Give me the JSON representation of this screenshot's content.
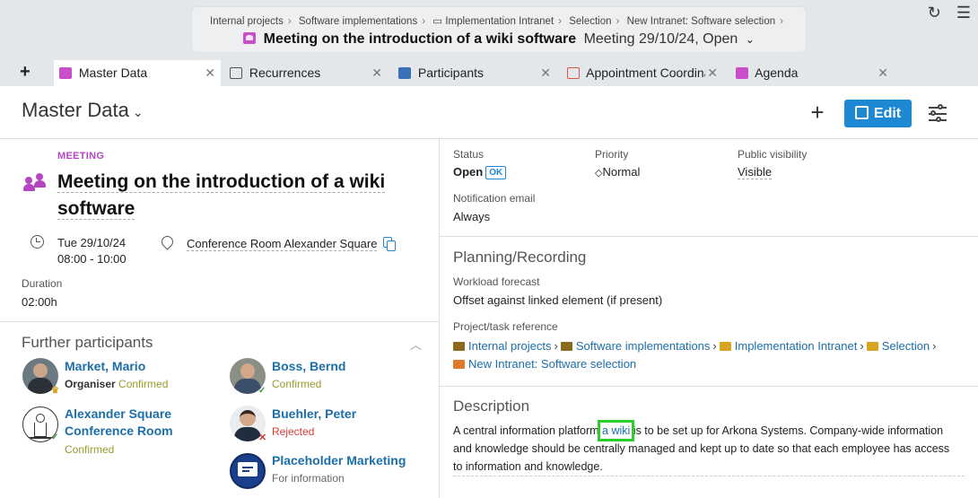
{
  "breadcrumbs": [
    "Internal projects",
    "Software implementations",
    "Implementation Intranet",
    "Selection",
    "New Intranet: Software selection"
  ],
  "header": {
    "title": "Meeting on the introduction of a wiki software",
    "meta": "Meeting 29/10/24, Open"
  },
  "tabs": [
    {
      "label": "Master Data",
      "color": "#c94ec9"
    },
    {
      "label": "Recurrences",
      "color": "#555555"
    },
    {
      "label": "Participants",
      "color": "#3b6fb6"
    },
    {
      "label": "Appointment Coordinat",
      "color": "#d9534f"
    },
    {
      "label": "Agenda",
      "color": "#c94ec9"
    }
  ],
  "page": {
    "title": "Master Data",
    "edit_label": "Edit"
  },
  "meeting": {
    "type_label": "MEETING",
    "title": "Meeting on the introduction of a wiki software",
    "date": "Tue 29/10/24",
    "time": "08:00 - 10:00",
    "location": "Conference Room Alexander Square",
    "duration_label": "Duration",
    "duration": "02:00h"
  },
  "participants": {
    "title": "Further participants",
    "items": [
      {
        "name": "Market, Mario",
        "role": "Organiser",
        "status": "Confirmed"
      },
      {
        "name": "Boss, Bernd",
        "role": "",
        "status": "Confirmed"
      },
      {
        "name": "Alexander Square Conference Room",
        "role": "",
        "status": "Confirmed"
      },
      {
        "name": "Buehler, Peter",
        "role": "",
        "status": "Rejected"
      },
      {
        "name": "Placeholder Marketing",
        "role": "",
        "status": "For information"
      }
    ]
  },
  "status": {
    "status_label": "Status",
    "status_value": "Open",
    "status_tag": "OK",
    "priority_label": "Priority",
    "priority_value": "Normal",
    "visibility_label": "Public visibility",
    "visibility_value": "Visible",
    "email_label": "Notification email",
    "email_value": "Always"
  },
  "planning": {
    "title": "Planning/Recording",
    "workload_label": "Workload forecast",
    "workload_value": "Offset against linked element (if present)",
    "ref_label": "Project/task reference",
    "refs": [
      "Internal projects",
      "Software implementations",
      "Implementation Intranet",
      "Selection",
      "New Intranet: Software selection"
    ]
  },
  "description": {
    "title": "Description",
    "text_before": "A central information platform ",
    "link": "a wiki",
    "text_after": " is to be set up for Arkona Systems. Company-wide information and knowledge should be centrally managed and kept up to date so that each employee has access to information and knowledge."
  },
  "colors": {
    "accent": "#1d88d3",
    "meeting": "#b546c2",
    "link": "#1c6ea8",
    "highlight": "#2ecc2e"
  }
}
